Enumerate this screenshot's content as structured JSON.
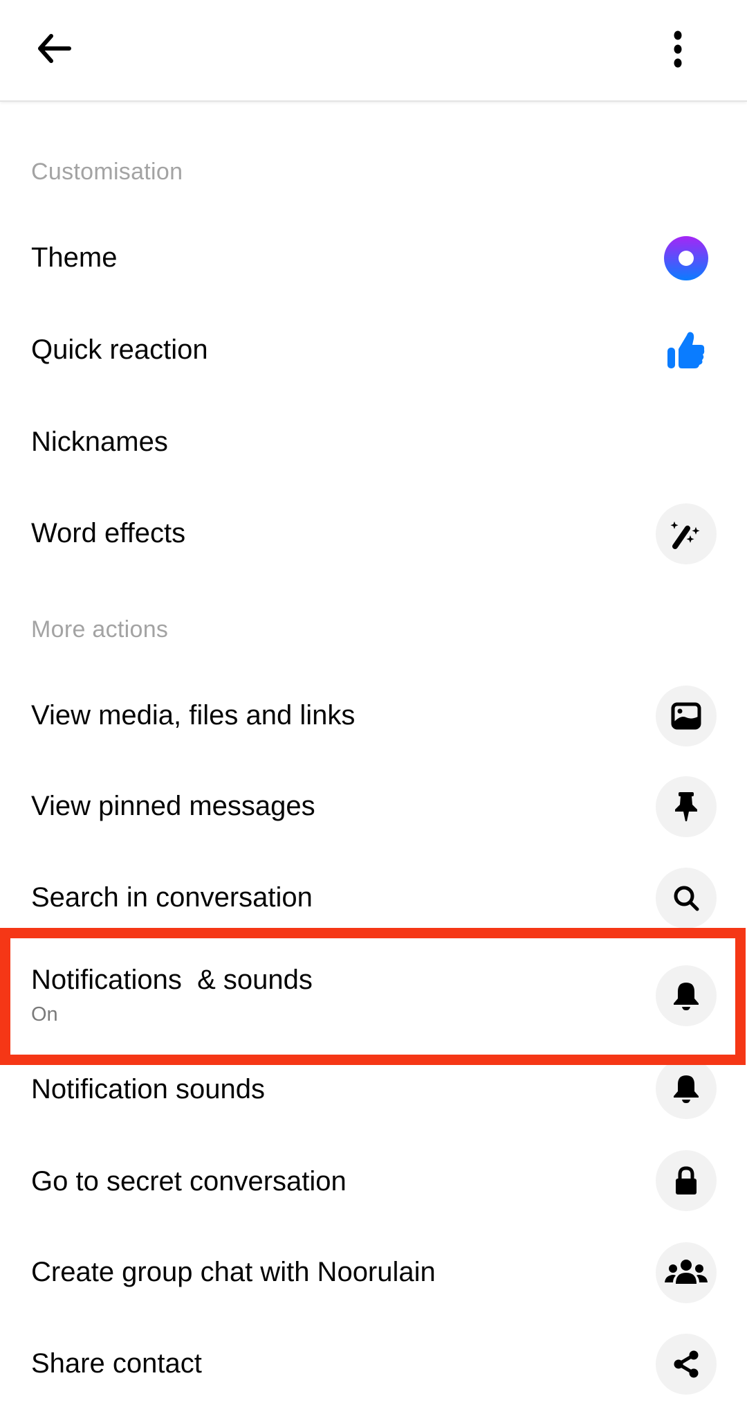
{
  "topbar": {
    "back_icon": "arrow-left-icon",
    "more_icon": "more-vertical-icon"
  },
  "sections": [
    {
      "header": "Customisation"
    },
    {
      "header": "More actions"
    }
  ],
  "rows": [
    {
      "label": "Theme",
      "icon": "theme-circle-icon"
    },
    {
      "label": "Quick reaction",
      "icon": "thumbs-up-icon"
    },
    {
      "label": "Nicknames",
      "icon": ""
    },
    {
      "label": "Word effects",
      "icon": "magic-wand-icon"
    },
    {
      "label": "View media, files and links",
      "icon": "image-icon"
    },
    {
      "label": "View pinned messages",
      "icon": "pin-icon"
    },
    {
      "label": "Search in conversation",
      "icon": "search-icon"
    },
    {
      "label": "Notifications  & sounds",
      "sublabel": "On",
      "icon": "bell-icon"
    },
    {
      "label": "Notification sounds",
      "icon": "bell-icon"
    },
    {
      "label": "Go to secret conversation",
      "icon": "lock-icon"
    },
    {
      "label": "Create group chat with Noorulain",
      "icon": "group-icon"
    },
    {
      "label": "Share contact",
      "icon": "share-icon"
    }
  ],
  "colors": {
    "theme_gradient_top": "#a526f5",
    "theme_gradient_bottom": "#0a7cff",
    "reaction_blue": "#0a7cff",
    "highlight_red": "#f53716",
    "section_header_gray": "#a3a3a3"
  }
}
